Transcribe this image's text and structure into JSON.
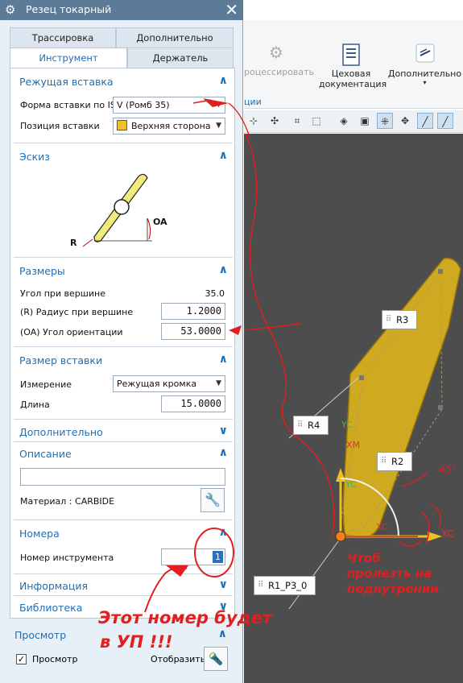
{
  "window": {
    "title": "Резец токарный"
  },
  "tabs": {
    "row1": [
      "Трассировка",
      "Дополнительно"
    ],
    "row2": [
      "Инструмент",
      "Держатель"
    ],
    "active": "Инструмент"
  },
  "sections": {
    "insert": {
      "header": "Режущая вставка",
      "shape_label": "Форма вставки по IS",
      "shape_value": "V (Ромб 35)",
      "position_label": "Позиция вставки",
      "position_value": "Верхняя сторона"
    },
    "sketch": {
      "header": "Эскиз",
      "label_oa": "OA",
      "label_r": "R"
    },
    "dims": {
      "header": "Размеры",
      "angle_label": "Угол при вершине",
      "angle_value": "35.0",
      "radius_label": "(R) Радиус при вершине",
      "radius_value": "1.2000",
      "orient_label": "(OA) Угол ориентации",
      "orient_value": "53.0000"
    },
    "insert_size": {
      "header": "Размер вставки",
      "measure_label": "Измерение",
      "measure_value": "Режущая кромка",
      "length_label": "Длина",
      "length_value": "15.0000"
    },
    "extra": {
      "header": "Дополнительно"
    },
    "description": {
      "header": "Описание",
      "description_value": "",
      "material_label": "Материал : CARBIDE"
    },
    "numbers": {
      "header": "Номера",
      "tool_number_label": "Номер инструмента",
      "tool_number_value": "1"
    },
    "info": {
      "header": "Информация"
    },
    "library": {
      "header": "Библиотека"
    },
    "preview": {
      "header": "Просмотр",
      "checkbox_label": "Просмотр",
      "display_label": "Отобразить"
    }
  },
  "ribbon": {
    "processed_label": "роцессировать",
    "shop_doc_label_1": "Цеховая",
    "shop_doc_label_2": "документация",
    "more_label": "Дополнительно",
    "group_label": "ции"
  },
  "viewport": {
    "tags": [
      "R3",
      "R4",
      "R2",
      "R1_P3_0"
    ],
    "axes": {
      "yc": "YC",
      "xm": "XM",
      "yc2": "YC",
      "xc": "XC",
      "xc2": "XC"
    }
  },
  "annotations": {
    "note_1_line_1": "Этот номер будет",
    "note_1_line_2": "в УП !!!",
    "note_2_line_1": "Чтоб",
    "note_2_line_2": "пролезть на",
    "note_2_line_3": "поднутрении",
    "angle_note": "45°"
  },
  "colors": {
    "accent": "#1f6fb5",
    "titlebar": "#5b7b97",
    "insert_yellow": "#d8b320",
    "annotation_red": "#e21f1f",
    "viewport_bg": "#4d4d4d"
  }
}
